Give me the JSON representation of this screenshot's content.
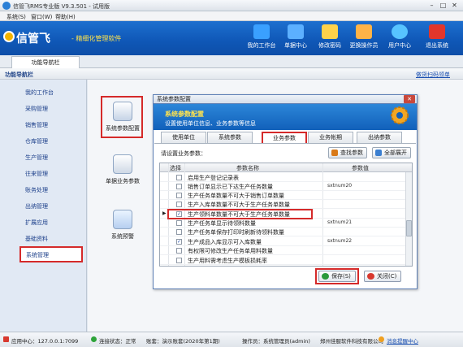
{
  "window": {
    "title": "信管飞RMS专业版 V9.3.501 - 试用版",
    "buttons": [
      "–",
      "□",
      "✕"
    ]
  },
  "menu": [
    "系统(S)",
    "窗口(W)",
    "帮助(H)"
  ],
  "header": {
    "brand": "信管飞",
    "slogan": "- 精细化管理软件",
    "toolbar": [
      {
        "label": "我的工作台",
        "icon": "monitor-icon",
        "color": "#3aa0ff"
      },
      {
        "label": "单据中心",
        "icon": "documents-icon",
        "color": "#5cb0ff"
      },
      {
        "label": "修改密码",
        "icon": "user-key-icon",
        "color": "#ffd24a"
      },
      {
        "label": "更换操作员",
        "icon": "users-icon",
        "color": "#ffb347"
      },
      {
        "label": "用户中心",
        "icon": "globe-icon",
        "color": "#57c4ff"
      },
      {
        "label": "退出系统",
        "icon": "power-icon",
        "color": "#e2362b"
      }
    ]
  },
  "tabs": {
    "active": "功能导航栏"
  },
  "section": {
    "title": "功能导航栏",
    "link": "做货扫码领单"
  },
  "sidebar": {
    "items": [
      "我的工作台",
      "采购管理",
      "销售管理",
      "仓库管理",
      "生产管理",
      "往来管理",
      "账务处理",
      "出纳管理",
      "扩展应用",
      "基础资料",
      "系统管理"
    ],
    "active_index": 10
  },
  "function_icons": [
    {
      "label": "系统参数配置",
      "icon": "database-gear-icon"
    },
    {
      "label": "单据业务参数",
      "icon": "document-settings-icon"
    },
    {
      "label": "系统预警",
      "icon": "alarm-icon"
    }
  ],
  "dialog": {
    "title": "系统参数配置",
    "close": "✕",
    "banner_title": "系统参数配置",
    "banner_subtitle": "设置使用单位信息、业务参数等信息",
    "tabs": [
      "使用单位",
      "系统参数",
      "业务参数",
      "业务帐期",
      "出纳参数"
    ],
    "active_tab": 2,
    "settings_label": "请设置业务参数：",
    "find_button": "查找参数",
    "expand_button": "全部展开",
    "columns": [
      "选择",
      "参数名称",
      "参数值"
    ],
    "rows": [
      {
        "name": "启用生产登记记录表",
        "checked": false,
        "value": ""
      },
      {
        "name": "销售订单显示已下达生产任务数量",
        "checked": false,
        "value": "sxtnum20"
      },
      {
        "name": "生产任务单数量不可大于销售订单数量",
        "checked": false,
        "value": ""
      },
      {
        "name": "生产入库单数量不可大于生产任务单数量",
        "checked": false,
        "value": ""
      },
      {
        "name": "生产领料单数量不可大于生产任务单数量",
        "checked": true,
        "value": "",
        "pointer": "▶"
      },
      {
        "name": "生产任务单显示待领料数量",
        "checked": false,
        "value": "sxtnum21"
      },
      {
        "name": "生产任务单保存打印时刷新待领料数量",
        "checked": false,
        "value": ""
      },
      {
        "name": "生产成品入库显示可入库数量",
        "checked": true,
        "value": "sxtnum22"
      },
      {
        "name": "有权限可修改生产任务单用料数量",
        "checked": false,
        "value": ""
      },
      {
        "name": "生产用料需考虑生产模板损耗率",
        "checked": false,
        "value": ""
      }
    ],
    "save_button": "保存(S)",
    "close_button": "关闭(C)"
  },
  "statusbar": {
    "app_center": "应用中心：127.0.0.1:7099",
    "connection": "连接状态：正常",
    "account": "账套：演示账套(2020年第1期)",
    "operator": "操作员：系统管理员(admin)",
    "company": "郑州佳服软件科技有限公司",
    "message": "消息提醒中心"
  }
}
